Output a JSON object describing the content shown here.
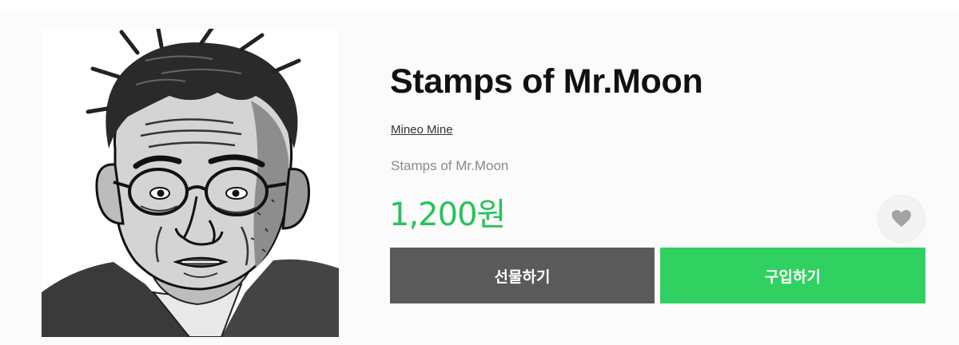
{
  "top_cut_text": "",
  "sticker": {
    "title": "Stamps of Mr.Moon",
    "author": "Mineo Mine",
    "description": "Stamps of Mr.Moon",
    "price": "1,200원"
  },
  "actions": {
    "gift_label": "선물하기",
    "buy_label": "구입하기",
    "favorite_icon": "heart-icon"
  },
  "colors": {
    "price": "#27c35a",
    "buy_button": "#30d161",
    "gift_button": "#5a5a5a",
    "top_text": "#27b5d8"
  }
}
